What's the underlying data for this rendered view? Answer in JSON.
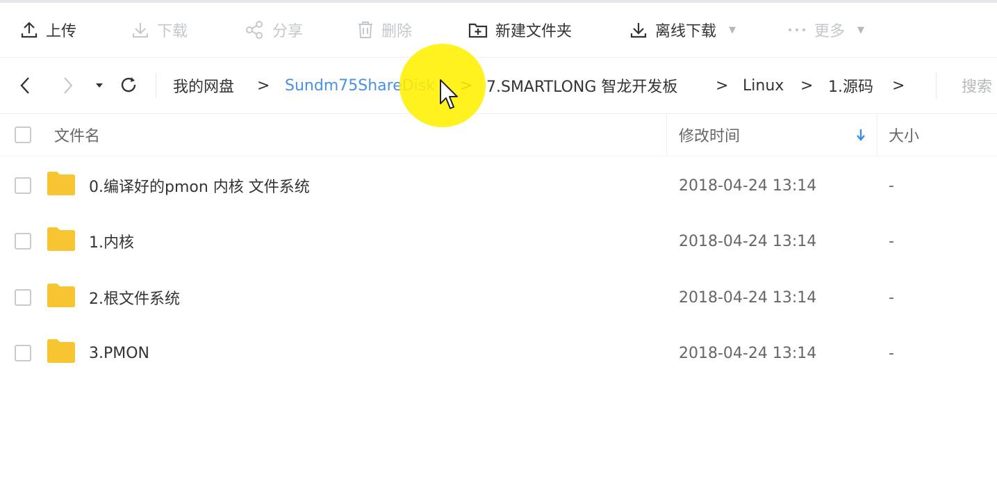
{
  "toolbar": {
    "upload_label": "上传",
    "download_label": "下载",
    "share_label": "分享",
    "delete_label": "删除",
    "new_folder_label": "新建文件夹",
    "offline_download_label": "离线下载",
    "more_label": "更多"
  },
  "nav": {
    "breadcrumbs": [
      "我的网盘",
      "Sundm75ShareDisk",
      "7.SMARTLONG 智龙开发板",
      "Linux",
      "1.源码"
    ],
    "separator": ">",
    "search_placeholder": "搜索"
  },
  "table": {
    "headers": {
      "name": "文件名",
      "modified": "修改时间",
      "size": "大小"
    },
    "rows": [
      {
        "name": "0.编译好的pmon 内核 文件系统",
        "modified": "2018-04-24 13:14",
        "size": "-"
      },
      {
        "name": "1.内核",
        "modified": "2018-04-24 13:14",
        "size": "-"
      },
      {
        "name": "2.根文件系统",
        "modified": "2018-04-24 13:14",
        "size": "-"
      },
      {
        "name": "3.PMON",
        "modified": "2018-04-24 13:14",
        "size": "-"
      }
    ]
  },
  "colors": {
    "link": "#4a90e2",
    "folder": "#f8c532",
    "sort_arrow": "#3a8ee6",
    "cursor_highlight": "#fff000"
  },
  "icons": [
    "upload-icon",
    "download-icon",
    "share-icon",
    "trash-icon",
    "folder-plus-icon",
    "offline-download-icon",
    "more-dots-icon",
    "back-icon",
    "forward-icon",
    "history-dropdown-icon",
    "refresh-icon",
    "sort-desc-icon",
    "folder-icon"
  ]
}
